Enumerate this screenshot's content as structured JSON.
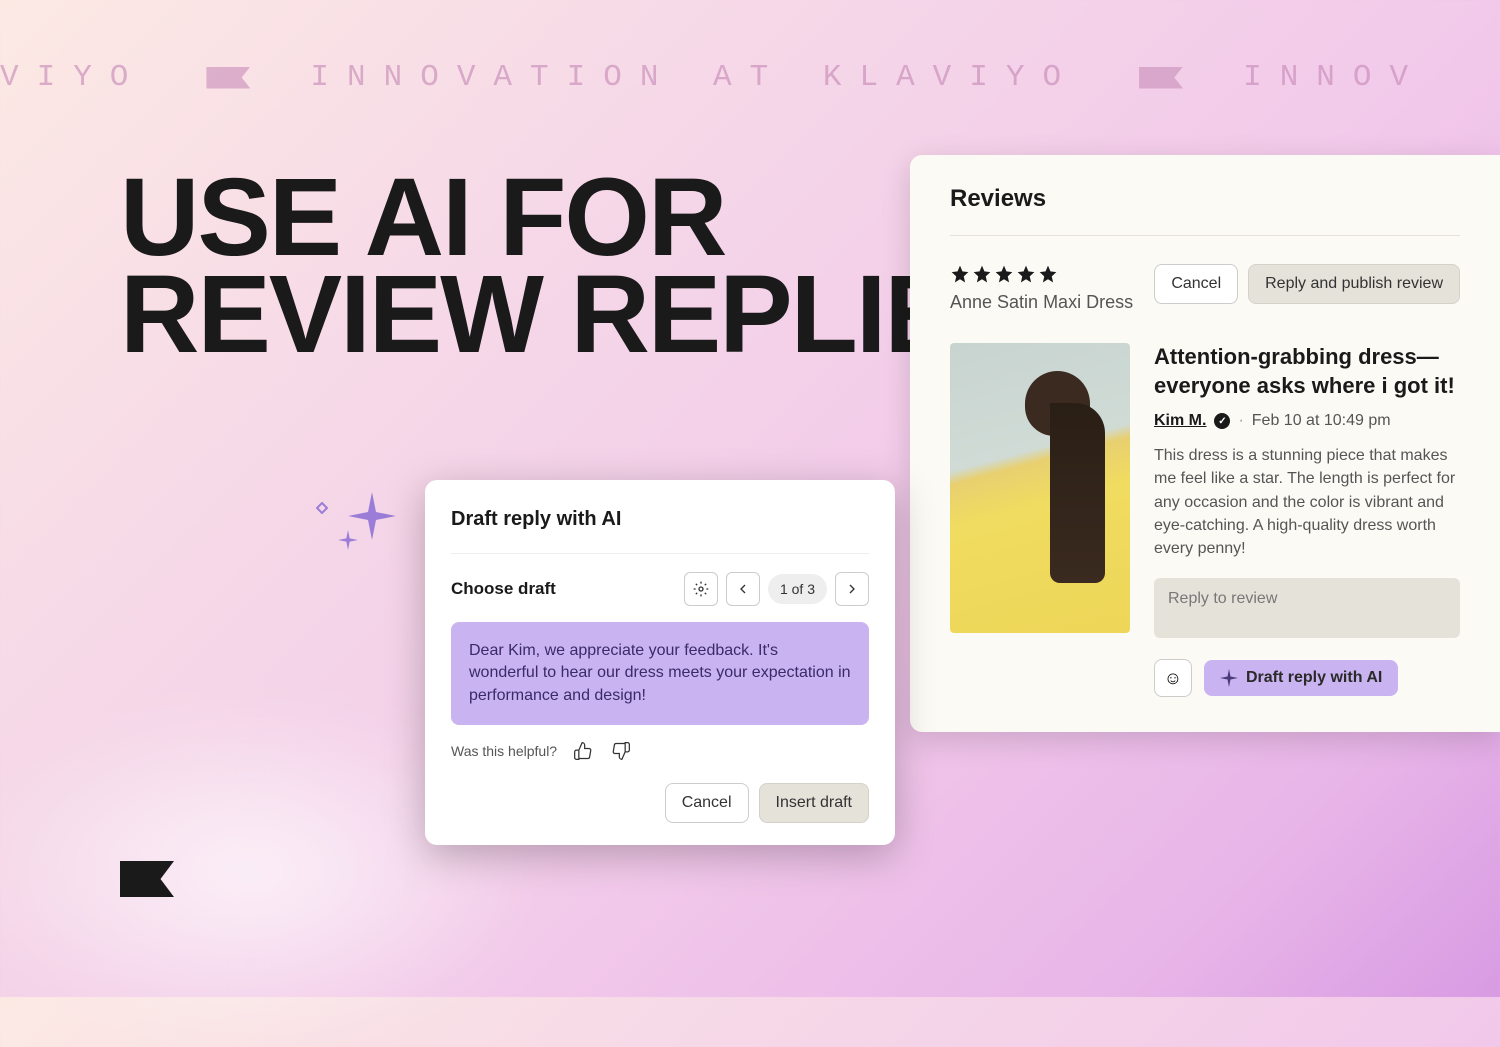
{
  "banner": {
    "fragment_left": "VIYO",
    "main": "INNOVATION AT KLAVIYO",
    "fragment_right": "INNOV"
  },
  "headline": {
    "line1": "USE AI FOR",
    "line2": "REVIEW REPLIES"
  },
  "reviews_panel": {
    "title": "Reviews",
    "product_name": "Anne Satin Maxi Dress",
    "star_rating": 5,
    "buttons": {
      "cancel": "Cancel",
      "reply_publish": "Reply and publish review"
    },
    "review": {
      "heading": "Attention-grabbing dress—everyone asks where i got it!",
      "reviewer_name": "Kim M.",
      "timestamp": "Feb 10 at 10:49 pm",
      "body": "This dress is a stunning piece that makes me feel like a star. The length is perfect for any occasion and the color is vibrant and eye-catching. A high-quality dress worth every penny!",
      "reply_placeholder": "Reply to review",
      "ai_button": "Draft reply with AI"
    }
  },
  "draft_modal": {
    "title": "Draft reply with AI",
    "choose_label": "Choose draft",
    "pager_count": "1 of 3",
    "draft_text": "Dear Kim, we appreciate your feedback. It's wonderful to hear our dress meets your expectation in performance and design!",
    "feedback_prompt": "Was this helpful?",
    "buttons": {
      "cancel": "Cancel",
      "insert": "Insert draft"
    }
  }
}
